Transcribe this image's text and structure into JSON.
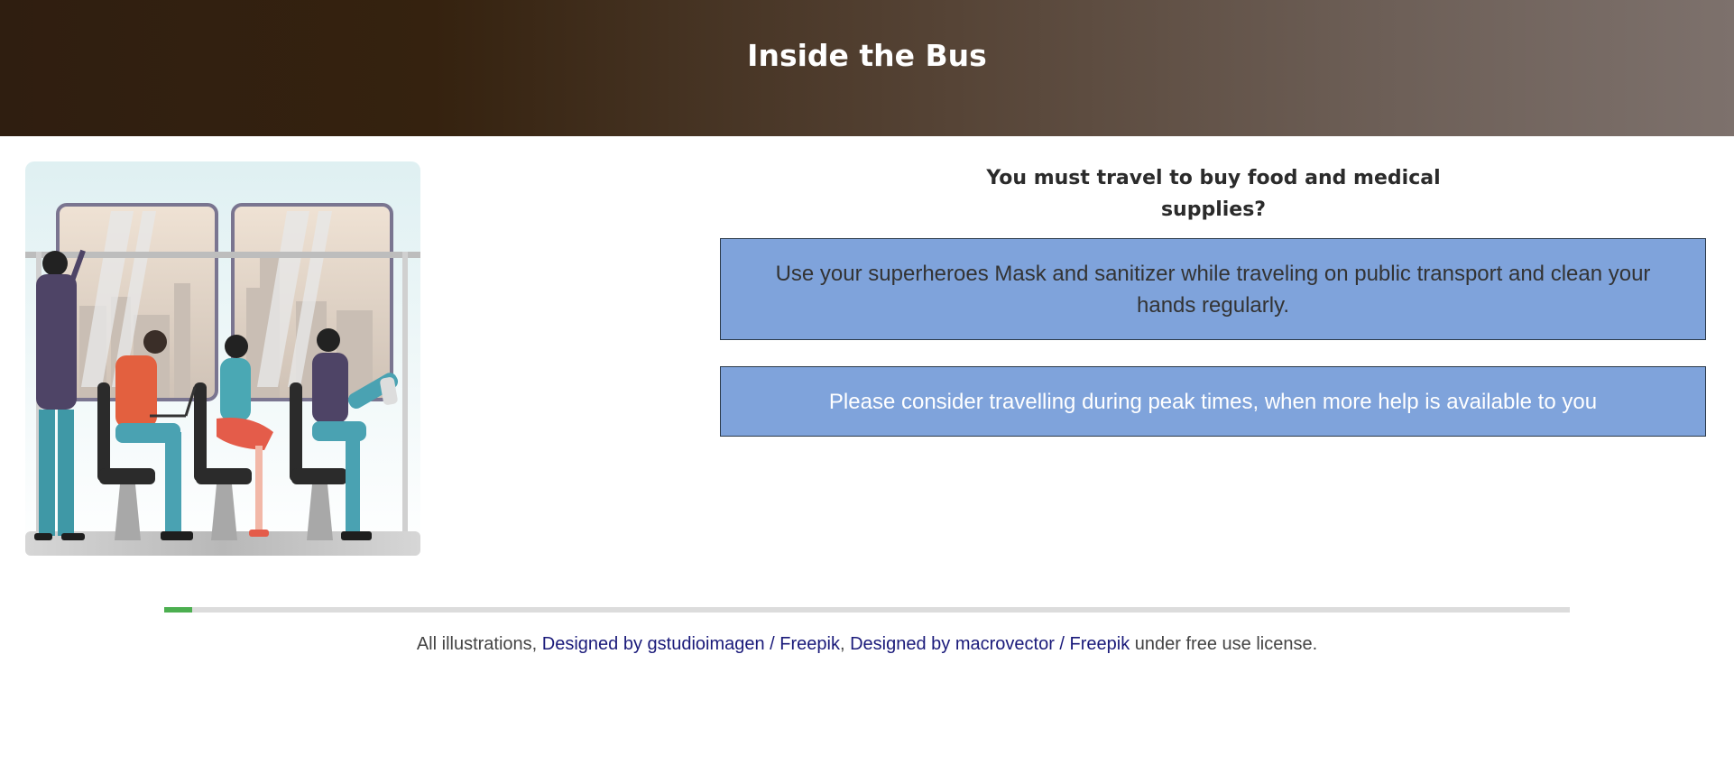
{
  "header": {
    "title": "Inside the Bus",
    "gradient": [
      "#2f1e10",
      "#7d716c"
    ]
  },
  "illustration": {
    "icon": "bus-passengers-illustration"
  },
  "quiz": {
    "question": "You must travel to buy food and medical supplies?",
    "options": [
      {
        "label": "Use your superheroes Mask and sanitizer while traveling on public transport and clean your hands regularly."
      },
      {
        "label": "Please consider travelling during peak times, when more help is available to you"
      }
    ],
    "option_color": "#7fa3db"
  },
  "progress": {
    "fraction": 0.02,
    "fill_color": "#4caf50"
  },
  "footer": {
    "prefix": "All illustrations, ",
    "link1": "Designed by gstudioimagen / Freepik",
    "sep": ", ",
    "link2": "Designed by macrovector / Freepik",
    "suffix": " under free use license."
  }
}
